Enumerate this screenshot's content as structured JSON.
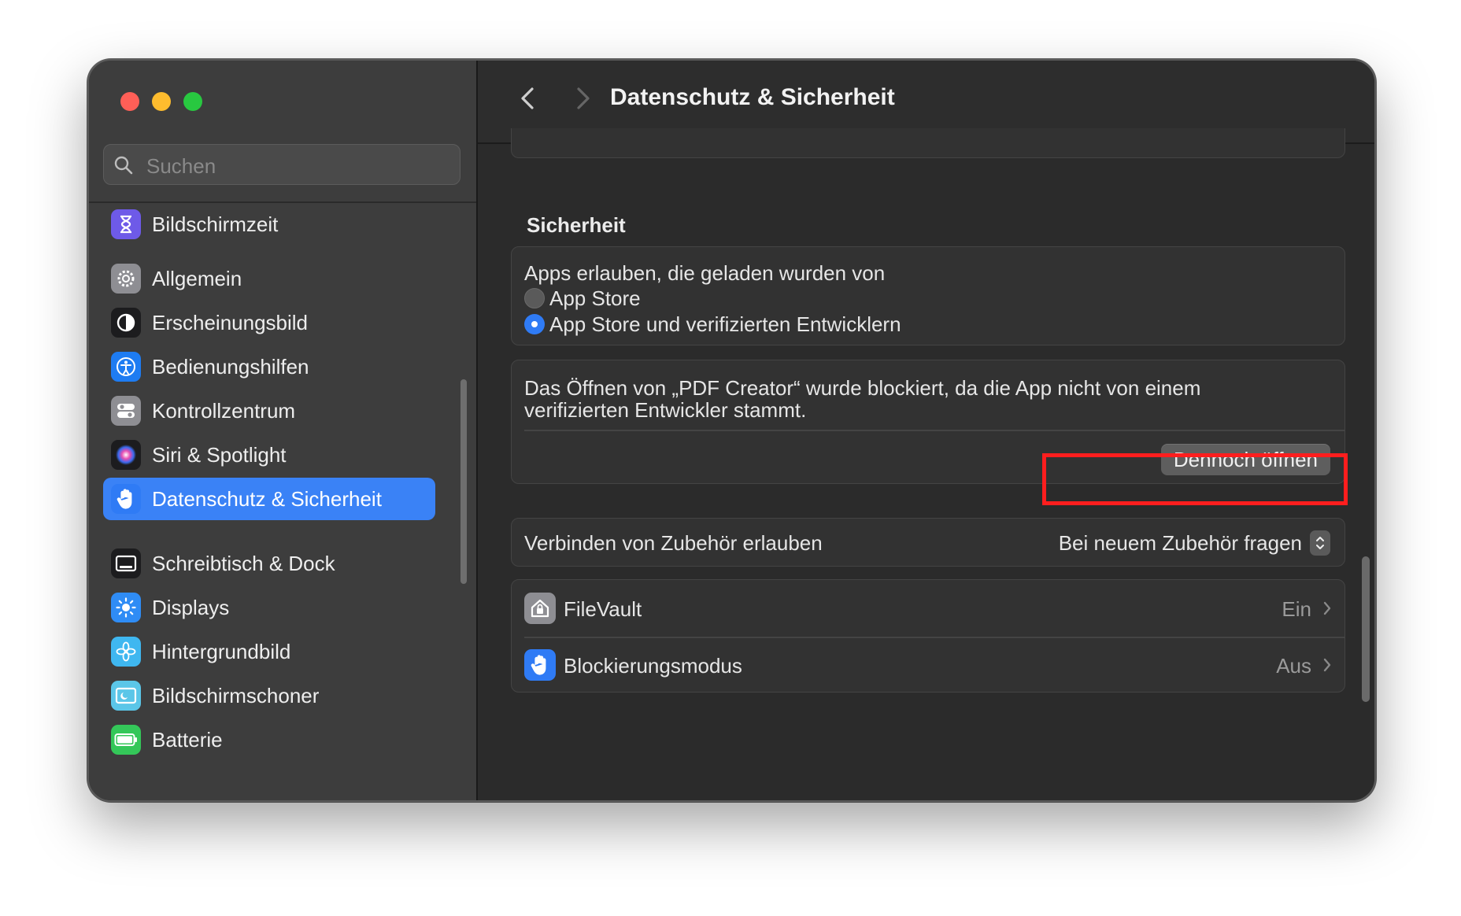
{
  "window": {
    "title": "Datenschutz & Sicherheit"
  },
  "sidebar": {
    "search_placeholder": "Suchen",
    "items": [
      {
        "label": "Bildschirmzeit",
        "icon": "hourglass-icon",
        "color": "#6e5ae8"
      },
      {
        "label": "Allgemein",
        "icon": "gear-icon",
        "color": "#8e8e93"
      },
      {
        "label": "Erscheinungsbild",
        "icon": "appearance-icon",
        "color": "#1c1c1e"
      },
      {
        "label": "Bedienungshilfen",
        "icon": "accessibility-icon",
        "color": "#1e7cf2"
      },
      {
        "label": "Kontrollzentrum",
        "icon": "toggles-icon",
        "color": "#8e8e93"
      },
      {
        "label": "Siri & Spotlight",
        "icon": "siri-icon",
        "color": "#7b3fe4"
      },
      {
        "label": "Datenschutz & Sicherheit",
        "icon": "hand-icon",
        "color": "#2f7bf5",
        "selected": true
      },
      {
        "label": "Schreibtisch & Dock",
        "icon": "dock-icon",
        "color": "#1c1c1e"
      },
      {
        "label": "Displays",
        "icon": "sun-icon",
        "color": "#2f8cf5"
      },
      {
        "label": "Hintergrundbild",
        "icon": "flower-icon",
        "color": "#3fb7f0"
      },
      {
        "label": "Bildschirmschoner",
        "icon": "screensaver-icon",
        "color": "#5bc6e8"
      },
      {
        "label": "Batterie",
        "icon": "battery-icon",
        "color": "#34c759"
      }
    ]
  },
  "main": {
    "section_title": "Sicherheit",
    "apps_allowed": {
      "heading": "Apps erlauben, die geladen wurden von",
      "options": [
        {
          "label": "App Store",
          "selected": false
        },
        {
          "label": "App Store und verifizierten Entwicklern",
          "selected": true
        }
      ]
    },
    "blocked": {
      "line1": "Das Öffnen von „PDF Creator“ wurde blockiert, da die App nicht von einem",
      "line2": "verifizierten Entwickler stammt.",
      "button": "Dennoch öffnen"
    },
    "accessories": {
      "label": "Verbinden von Zubehör erlauben",
      "value": "Bei neuem Zubehör fragen"
    },
    "rows": [
      {
        "label": "FileVault",
        "value": "Ein",
        "icon": "house-lock-icon"
      },
      {
        "label": "Blockierungsmodus",
        "value": "Aus",
        "icon": "hand-icon"
      }
    ]
  },
  "colors": {
    "accent": "#3a82f6",
    "highlight": "#ff1e1e"
  }
}
